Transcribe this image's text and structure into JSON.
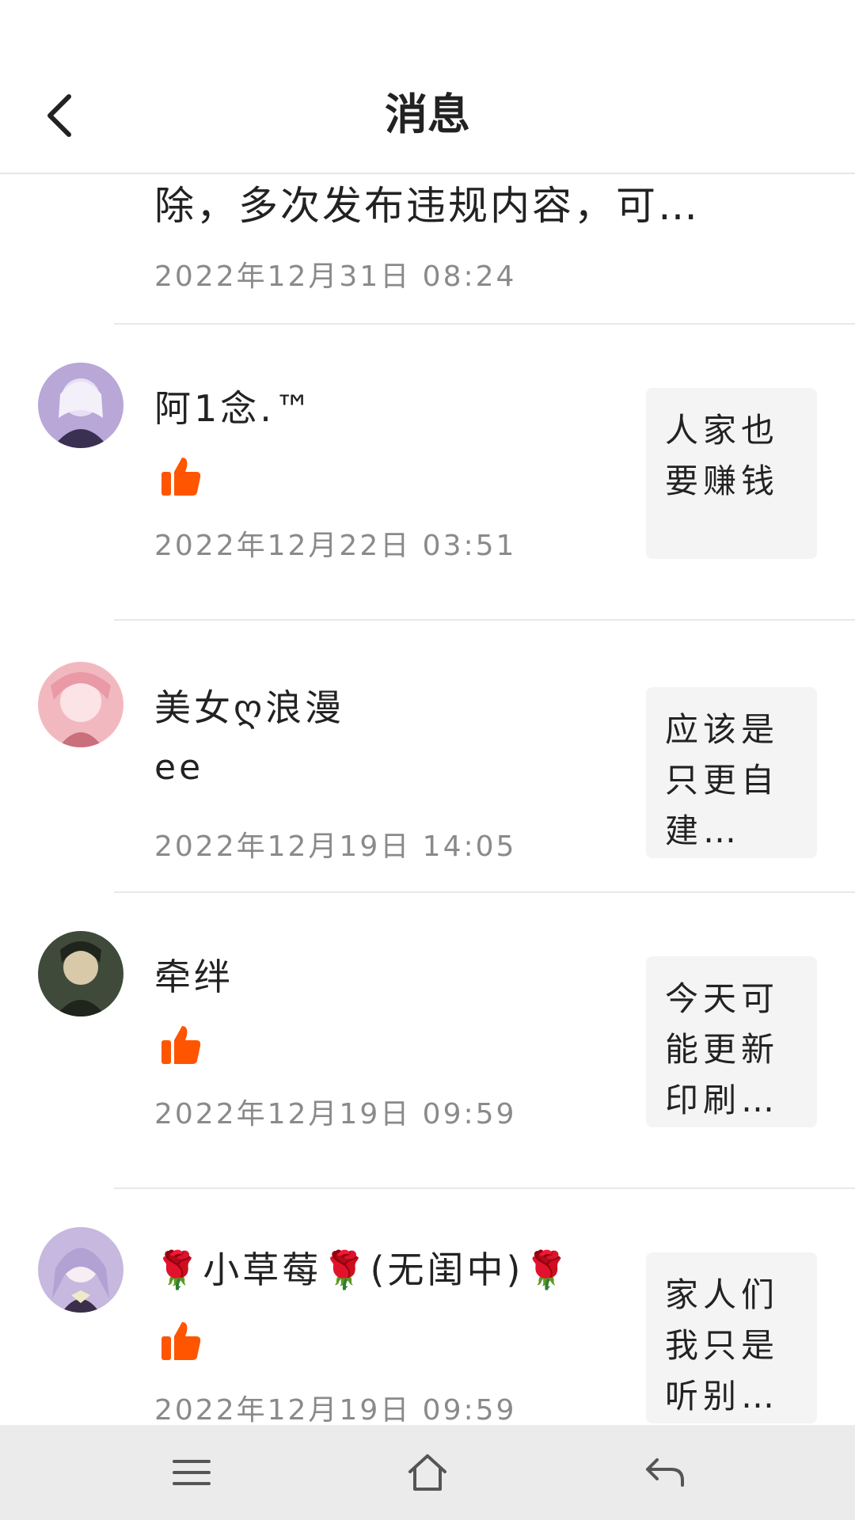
{
  "header": {
    "title": "消息"
  },
  "fragment": {
    "text": "除，多次发布违规内容，可…",
    "time": "2022年12月31日 08:24"
  },
  "messages": [
    {
      "name": "阿1念.™",
      "content": "",
      "liked": true,
      "time": "2022年12月22日 03:51",
      "quote": "人家也要赚钱",
      "avatar_colors": [
        "#b9a7d8",
        "#e7dff5",
        "#3a3152"
      ]
    },
    {
      "name": "美女ღ浪漫",
      "content": "ee",
      "liked": false,
      "time": "2022年12月19日 14:05",
      "quote": "应该是只更自建…",
      "avatar_colors": [
        "#f2b8c0",
        "#fbe3e6",
        "#c9707c"
      ]
    },
    {
      "name": "牵绊",
      "content": "",
      "liked": true,
      "time": "2022年12月19日 09:59",
      "quote": "今天可能更新印刷…",
      "avatar_colors": [
        "#3f4a3a",
        "#a9a087",
        "#1f241d"
      ]
    },
    {
      "name": "🌹小草莓🌹(无闺中)🌹",
      "content": "",
      "liked": true,
      "time": "2022年12月19日 09:59",
      "quote": "家人们我只是听别…",
      "avatar_colors": [
        "#c7b8e0",
        "#f0e9c8",
        "#3a2e48"
      ]
    }
  ],
  "colors": {
    "like": "#ff5500",
    "time": "#8a8a8a",
    "quote_bg": "#f4f4f4",
    "nav_bg": "#ebebeb"
  },
  "icons": {
    "back": "chevron-left-icon",
    "like": "thumbs-up-icon",
    "menu": "menu-icon",
    "home": "home-icon",
    "return": "return-icon"
  }
}
